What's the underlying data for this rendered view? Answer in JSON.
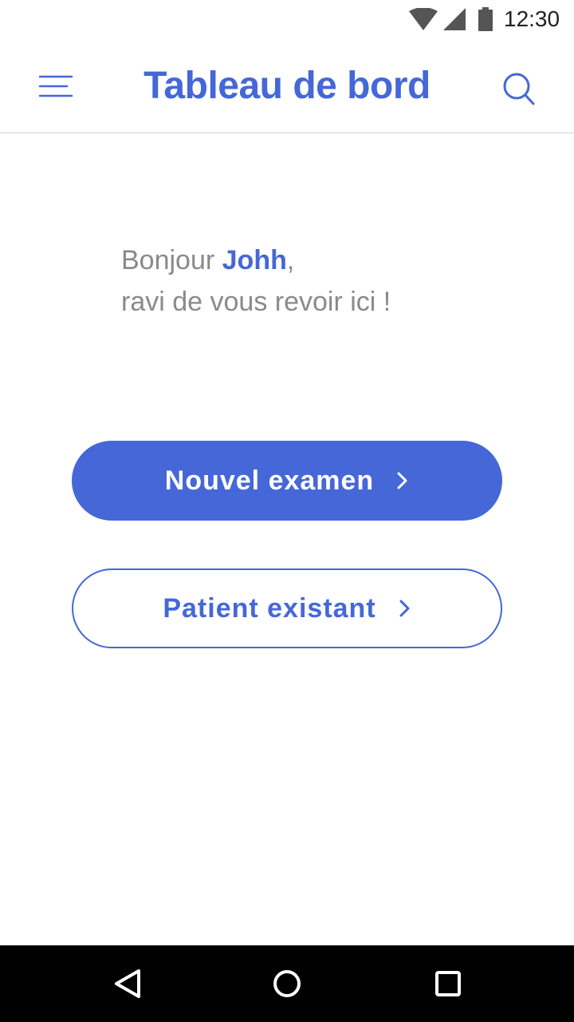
{
  "status_bar": {
    "time": "12:30",
    "icons": [
      "wifi-icon",
      "signal-icon",
      "battery-icon"
    ]
  },
  "app_bar": {
    "title": "Tableau de bord",
    "menu_icon": "menu-icon",
    "search_icon": "search-icon"
  },
  "greeting": {
    "prefix": "Bonjour ",
    "name": "Johh",
    "suffix": ",",
    "line2": "ravi de vous revoir ici !"
  },
  "actions": {
    "new_exam": "Nouvel examen",
    "existing_patient": "Patient existant"
  },
  "nav_bar": {
    "icons": [
      "back-icon",
      "home-icon",
      "recent-apps-icon"
    ]
  },
  "colors": {
    "accent": "#4567d8",
    "greeting_text": "#8a8a8a",
    "nav_background": "#000000"
  }
}
